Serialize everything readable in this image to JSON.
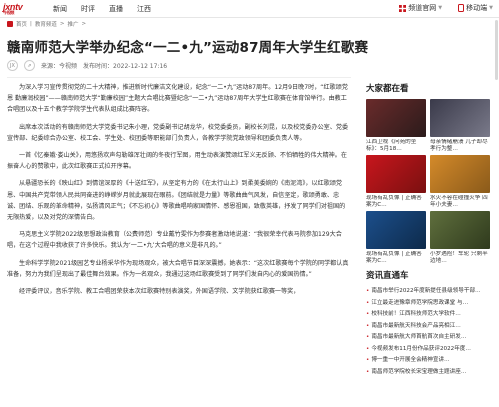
{
  "header": {
    "logo_text": "jxntv",
    "logo_sub": "今视频",
    "nav": [
      "新闻",
      "时评",
      "直播",
      "江西"
    ],
    "app_label": "频道官网",
    "phone_label": "移动端"
  },
  "breadcrumb": [
    "首页",
    "教育频道",
    "推广"
  ],
  "article": {
    "title": "赣南师范大学举办纪念“一二•九”运动87周年大学生红歌赛",
    "source": "来源：今视频",
    "date": "发布时间：2022-12-12 17:16",
    "paragraphs": [
      "为深入学习宣传贯彻党的二十大精神，推进新时代廉洁文化建设，纪念“一二•九”运动87周年。12月9日晚7时，“红歌颂党恩 勤廉润校园”——赣南师范大学“勤廉校园”主题大合唱比赛暨纪念“一二•九”运动87周年大学生红歌赛在体育馆举行。由教工合唱团以及十五个教学学院学生代表队组成比赛阵容。",
      "出席本次活动的有赣南师范大学党委书记朱小理，党委副书记胡龙华，校党委委员，副校长刘昆，以及校党委办公室、党委宣传部、纪委综合办公室、校工会、学生处、校团委等职能部门负责人，各教学学院党政领导和团委负责人等。",
      "一首《忆秦娥·娄山关》，用悠扬欢声勾勒雄浑壮阔的冬夜行军图，用生动表演赞颂红军义无反顾、不怕牺牲的伟大精神。在振奋人心的赞歌中，此次红歌赛正式拉开序幕。",
      "从悬疆恐长的《映山红》到情谊深厚的《十送红军》，从坚定有力的《在太行山上》到柔美委婉的《南泥湾》，以红歌颂党恩、中国共产党带领人民共同奋进的峥嵘岁月就此展现在眼前。《团结就是力量》等歌曲曲气风发，自信坚定，歌颂勇敢、忠诚、团结、乐观的革命精神，弘扬清风正气；《不忘初心》等歌曲唱响家国情怀、感恩祖国，致敬英雄，抒发了同学们对祖国的无限热爱，以及对党的深情告白。",
      "马克思主义学院2022级思想政治教育（公费师范）专业戴竹雯作为参赛者激动地说道：“我很荣幸代表马院参加129大合唱，在这个过程中我收获了许多快乐。我认为‘一二•九’大合唱的意义是非凡的。”",
      "生命科学学院2021级园艺专业杨采华作为现场观众，被大合唱节目深深震撼，她表示：“这次红歌赛每个学院的同学都认真准备，努力为我们呈现出了最佳舞台效果。作为一名观众，我通过这场红歌赛受到了同学们发自内心的爱国热情。”",
      "经评委评议，音乐学院、教工合唱团荣获本次红歌赛特别表演奖，外国语学院、文学院获红歌赛一等奖，"
    ]
  },
  "sidebar": {
    "heading": "大家都在看",
    "thumbs": [
      {
        "caption": "江西卫视《问苑的坐标》：5月18…",
        "color": "#6a2b2b"
      },
      {
        "caption": "母亲情绪崩溃 儿子却尽孝行为整…",
        "color": "#3a3a4a"
      },
      {
        "caption": "现场有乱负像 | 正确答案为C…",
        "color": "#c8161d"
      },
      {
        "caption": "水火不容在碰撞火争 四年小夫妻…",
        "color": "#d48a2a"
      },
      {
        "caption": "现场有乱负像 | 正确答案为C…",
        "color": "#1c4f8c"
      },
      {
        "caption": "小罗遇险！车轮 只剩半边地…",
        "color": "#5f6f3d"
      }
    ],
    "news_heading": "资讯直通车",
    "news": [
      "南昌市举行2022年度新提任县级领导干部…",
      "江立最走进豫章师范学院思政课堂 与…",
      "校科技前！江西科技师范大学软件…",
      "南昌市最新航天科技会产品亮相江…",
      "南昌市最新航大师首航首次自主研发…",
      "今视频发布11月份作品获评2022年度…",
      "博一重一中开展全会精神宣讲…",
      "南昌师范学院校长宋宝理做主题讲座…"
    ]
  }
}
